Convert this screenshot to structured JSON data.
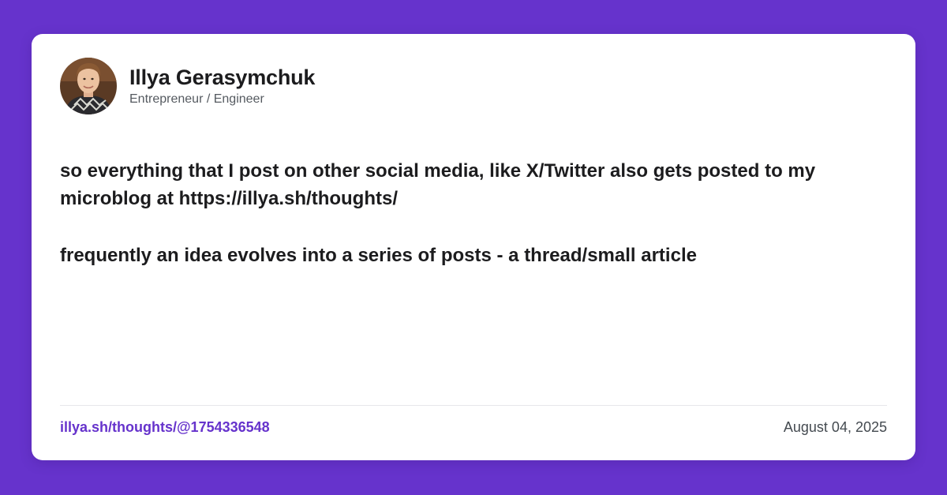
{
  "author": {
    "name": "Illya Gerasymchuk",
    "title": "Entrepreneur / Engineer"
  },
  "post": {
    "paragraphs": [
      "so everything that I post on other social media, like X/Twitter also gets posted to my microblog at https://illya.sh/thoughts/",
      "frequently an idea evolves into a series of posts - a thread/small article"
    ]
  },
  "footer": {
    "link": "illya.sh/thoughts/@1754336548",
    "date": "August 04, 2025"
  },
  "colors": {
    "background": "#6633cc",
    "card": "#ffffff",
    "accent": "#6633cc",
    "text": "#1c1c1e"
  }
}
